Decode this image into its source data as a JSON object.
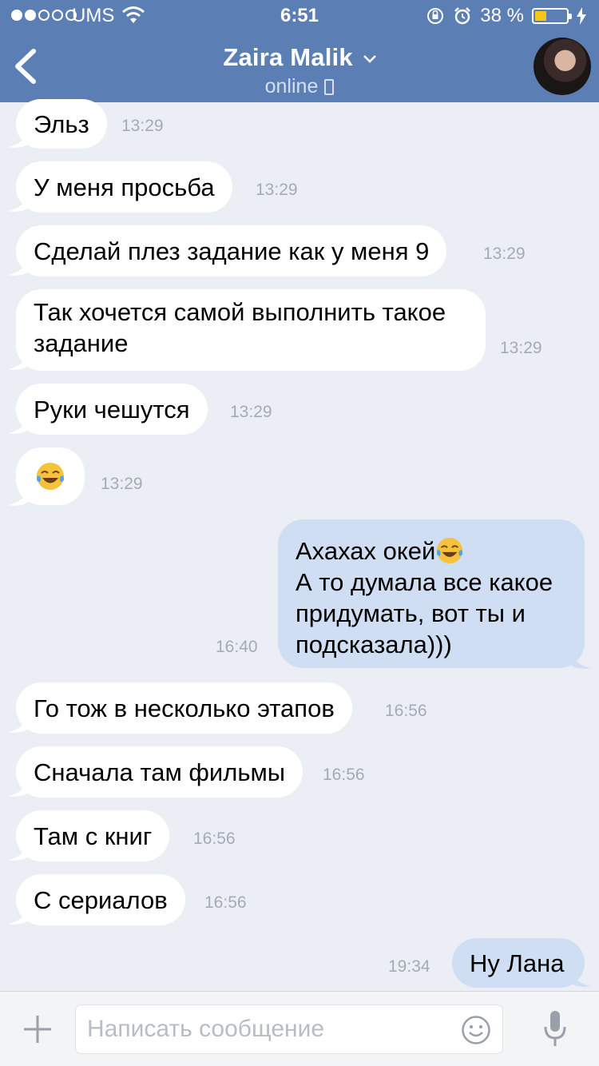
{
  "status_bar": {
    "carrier": "UMS",
    "time": "6:51",
    "battery_percent": "38 %",
    "battery_level": 0.38
  },
  "header": {
    "contact_name": "Zaira Malik",
    "presence": "online",
    "icons": [
      "back-chevron-icon",
      "chevron-down-icon",
      "mobile-phone-icon",
      "avatar"
    ]
  },
  "messages": [
    {
      "text": "Эльз",
      "time": "13:29",
      "direction": "in"
    },
    {
      "text": "У меня просьба",
      "time": "13:29",
      "direction": "in"
    },
    {
      "text": "Сделай плез задание как у меня 9",
      "time": "13:29",
      "direction": "in"
    },
    {
      "text": "Так хочется самой выполнить такое задание",
      "time": "13:29",
      "direction": "in"
    },
    {
      "text": "Руки чешутся",
      "time": "13:29",
      "direction": "in"
    },
    {
      "text": "",
      "emoji": "tears-of-joy-emoji",
      "time": "13:29",
      "direction": "in"
    },
    {
      "text_line1": "Ахахах окей",
      "emoji": "tears-of-joy-emoji",
      "text_rest": "А то думала все какое придумать, вот ты и подсказала)))",
      "time": "16:40",
      "direction": "out"
    },
    {
      "text": "Го тож в несколько этапов",
      "time": "16:56",
      "direction": "in"
    },
    {
      "text": "Сначала там фильмы",
      "time": "16:56",
      "direction": "in"
    },
    {
      "text": "Там с книг",
      "time": "16:56",
      "direction": "in"
    },
    {
      "text": "С сериалов",
      "time": "16:56",
      "direction": "in"
    },
    {
      "text": "Ну Лана",
      "time": "19:34",
      "direction": "out"
    }
  ],
  "composer": {
    "placeholder": "Написать сообщение",
    "icons": [
      "plus-icon",
      "smiley-icon",
      "microphone-icon"
    ]
  },
  "colors": {
    "header": "#5b7fb4",
    "background": "#ebeef5",
    "incoming_bubble": "#ffffff",
    "outgoing_bubble": "#cfdef3",
    "timestamp": "#a4abb6"
  }
}
